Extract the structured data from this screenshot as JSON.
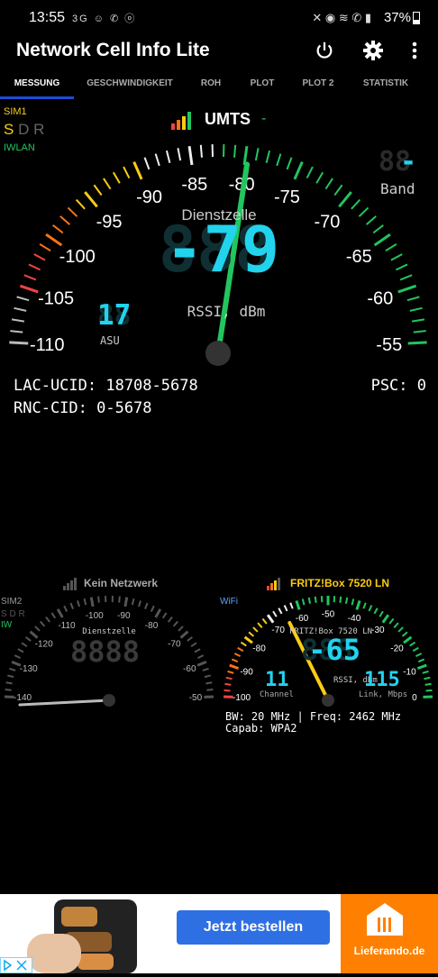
{
  "status_bar": {
    "time": "13:55",
    "left_icons": "3G ☺ ✆ ⓞ",
    "battery": "37%"
  },
  "app": {
    "title": "Network Cell Info Lite",
    "colors": {
      "accent": "#1e4bd8",
      "cyan": "#22d3ee",
      "gauge_green": "#22c55e",
      "yellow": "#facc15"
    }
  },
  "tabs": [
    "MESSUNG",
    "GESCHWINDIGKEIT",
    "ROH",
    "PLOT",
    "PLOT 2",
    "STATISTIK"
  ],
  "main_gauge": {
    "sim_label": "SIM1",
    "sim_s": "S",
    "sim_dr": "D R",
    "iwlan": "IWLAN",
    "network_type": "UMTS",
    "network_suffix": "-",
    "scale_labels": [
      "-110",
      "-105",
      "-100",
      "-95",
      "-90",
      "-85",
      "-80",
      "-75",
      "-70",
      "-65",
      "-60",
      "-55"
    ],
    "center_label": "Dienstzelle",
    "value": "-79",
    "unit": "RSSI, dBm",
    "band_value": "-",
    "band_label": "Band",
    "asu_value": "17",
    "asu_label": "ASU",
    "needle_value": -79
  },
  "cell_info": {
    "lac_ucid": "LAC-UCID: 18708-5678",
    "psc": "PSC: 0",
    "rnc_cid": "RNC-CID: 0-5678"
  },
  "sim2_gauge": {
    "title": "Kein Netzwerk",
    "sim_label": "SIM2",
    "sim_sdr": "S D R",
    "iw": "IW",
    "scale_labels": [
      "-140",
      "-130",
      "-120",
      "-110",
      "-100",
      "-90",
      "-80",
      "-70",
      "-60",
      "-50"
    ],
    "center_label": "Dienstzelle",
    "value": "8888"
  },
  "wifi_gauge": {
    "title": "FRITZ!Box 7520 LN",
    "wifi_label": "WiFi",
    "scale_labels": [
      "-100",
      "-90",
      "-80",
      "-70",
      "-60",
      "-50",
      "-40",
      "-30",
      "-20",
      "-10",
      "0"
    ],
    "ssid_small": "FRITZ!Box 7520 LN",
    "value": "-65",
    "unit": "RSSI, dBm",
    "channel_value": "11",
    "channel_label": "Channel",
    "link_value": "115",
    "link_label": "Link, Mbps",
    "info_line1": "BW: 20 MHz | Freq: 2462 MHz",
    "info_line2": "Capab: WPA2",
    "needle_value": -65
  },
  "ad": {
    "button_label": "Jetzt bestellen",
    "brand": "Lieferando.de"
  }
}
